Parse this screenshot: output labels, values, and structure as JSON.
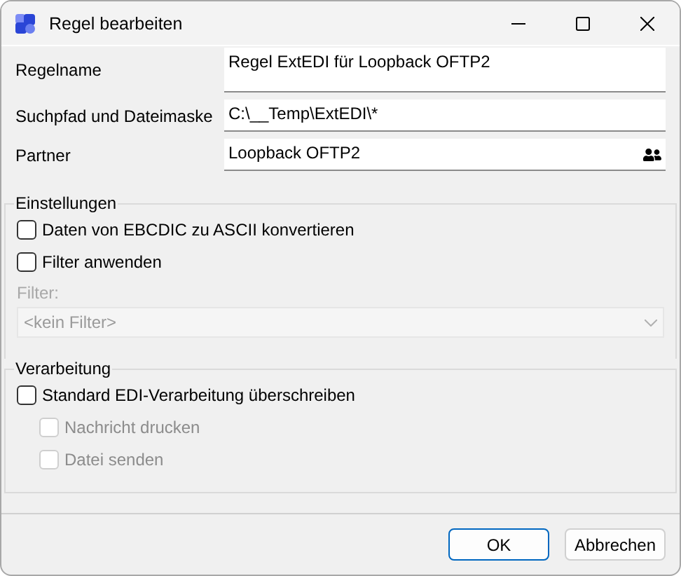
{
  "window": {
    "title": "Regel bearbeiten"
  },
  "fields": [
    {
      "kind": "multiline",
      "label": "Regelname",
      "value": "Regel ExtEDI für Loopback OFTP2"
    },
    {
      "kind": "text",
      "label": "Suchpfad und Dateimaske",
      "value": "C:\\__Temp\\ExtEDI\\*"
    },
    {
      "kind": "picker",
      "label": "Partner",
      "value": "Loopback OFTP2"
    }
  ],
  "settings": {
    "title": "Einstellungen",
    "options": [
      {
        "label": "Daten von EBCDIC zu ASCII konvertieren",
        "checked": false,
        "disabled": false
      },
      {
        "label": "Filter anwenden",
        "checked": false,
        "disabled": false
      }
    ],
    "filter": {
      "label": "Filter:",
      "value": "<kein Filter>",
      "disabled": true
    }
  },
  "processing": {
    "title": "Verarbeitung",
    "options": [
      {
        "label": "Standard EDI-Verarbeitung überschreiben",
        "checked": false,
        "disabled": false,
        "children": [
          {
            "label": "Nachricht drucken",
            "checked": false,
            "disabled": true
          },
          {
            "label": "Datei senden",
            "checked": false,
            "disabled": true
          }
        ]
      }
    ]
  },
  "buttons": [
    {
      "label": "OK",
      "default": true
    },
    {
      "label": "Abbrechen",
      "default": false
    }
  ]
}
